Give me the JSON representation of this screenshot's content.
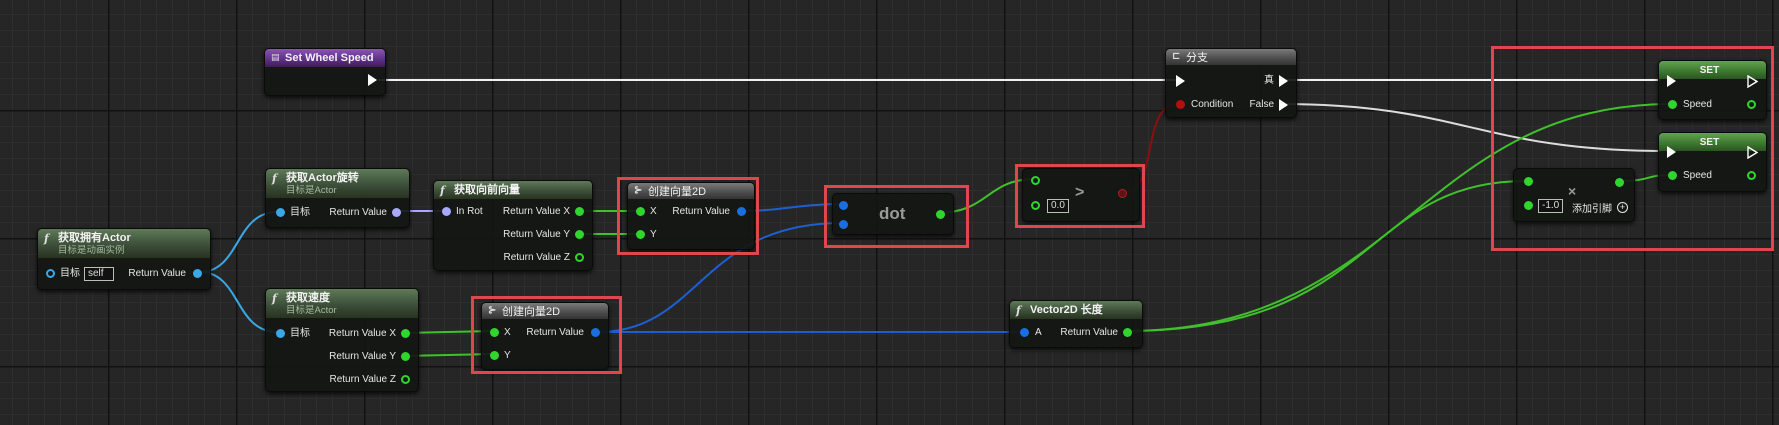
{
  "nodes": {
    "set_wheel_speed": {
      "title": "Set Wheel Speed"
    },
    "get_owner": {
      "title": "获取拥有Actor",
      "subtitle": "目标是动画实例",
      "target_label": "目标",
      "target_value": "self",
      "return_label": "Return Value"
    },
    "get_rotation": {
      "title": "获取Actor旋转",
      "subtitle": "目标是Actor",
      "target_label": "目标",
      "return_label": "Return Value"
    },
    "get_velocity": {
      "title": "获取速度",
      "subtitle": "目标是Actor",
      "target_label": "目标",
      "rx": "Return Value X",
      "ry": "Return Value Y",
      "rz": "Return Value Z"
    },
    "get_forward": {
      "title": "获取向前向量",
      "in_label": "In Rot",
      "rx": "Return Value X",
      "ry": "Return Value Y",
      "rz": "Return Value Z"
    },
    "make_vec_a": {
      "title": "创建向量2D",
      "x": "X",
      "y": "Y",
      "ret": "Return Value"
    },
    "make_vec_b": {
      "title": "创建向量2D",
      "x": "X",
      "y": "Y",
      "ret": "Return Value"
    },
    "dot": {
      "title": "dot"
    },
    "greater": {
      "op": ">",
      "default_b": "0.0"
    },
    "branch": {
      "title": "分支",
      "condition": "Condition",
      "true_label": "真",
      "false_label": "False"
    },
    "vec_len": {
      "title": "Vector2D 长度",
      "a_label": "A",
      "ret": "Return Value"
    },
    "set_a": {
      "title": "SET",
      "pin": "Speed"
    },
    "set_b": {
      "title": "SET",
      "pin": "Speed"
    },
    "multiply": {
      "op": "×",
      "default_b": "-1.0",
      "add_pin": "添加引脚"
    }
  },
  "colors": {
    "exec_wire": "#f0f0f0",
    "float_wire": "#3fc12a",
    "vector2d_wire": "#1d5fd0",
    "object_wire": "#3aa8e6",
    "rotator_wire": "#a8a8ff",
    "bool_wire": "#8a1010",
    "highlight": "#e0474c"
  },
  "icons": {
    "function": "function-icon",
    "struct": "struct-make-icon",
    "branch": "branch-icon",
    "event": "custom-event-icon",
    "add_pin": "add-pin-icon"
  }
}
